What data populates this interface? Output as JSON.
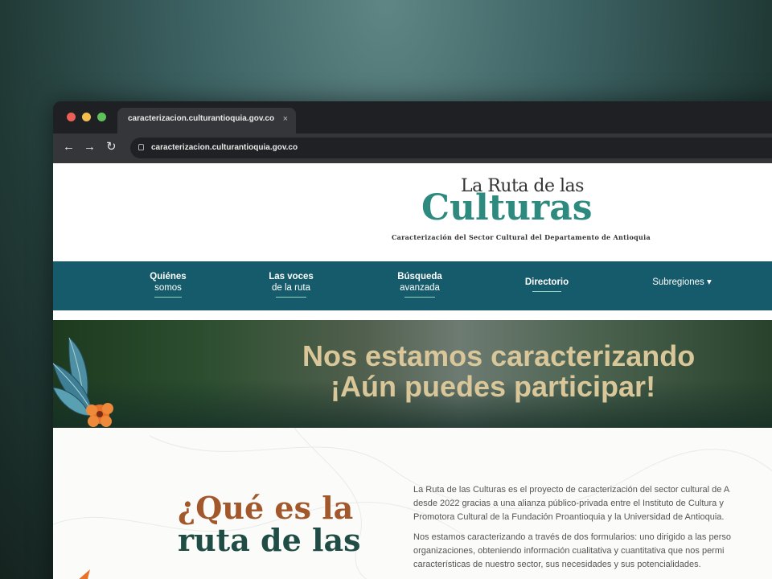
{
  "browser": {
    "tab_title": "caracterizacion.culturantioquia.gov.co",
    "tab_close": "×",
    "url": "caracterizacion.culturantioquia.gov.co",
    "back": "←",
    "forward": "→",
    "reload": "↻"
  },
  "header": {
    "logo_top": "La Ruta de las",
    "logo_main": "Culturas",
    "logo_sub": "Caracterización del Sector Cultural del Departamento de Antioquia"
  },
  "nav": {
    "items": [
      {
        "line1": "Quiénes",
        "line2": "somos"
      },
      {
        "line1": "Las voces",
        "line2": "de la ruta"
      },
      {
        "line1": "Búsqueda",
        "line2": "avanzada"
      },
      {
        "line1": "Directorio",
        "line2": ""
      },
      {
        "line1": "Subregiones ▾",
        "line2": ""
      }
    ]
  },
  "banner": {
    "line1": "Nos estamos caracterizando",
    "line2": "¡Aún puedes participar!"
  },
  "about": {
    "heading_line1": "¿Qué es la",
    "heading_line2": "ruta de las",
    "paragraph1_line1": "La Ruta de las Culturas es el proyecto de caracterización del sector cultural de A",
    "paragraph1_line2": "desde 2022 gracias a una alianza público-privada entre el Instituto de Cultura y",
    "paragraph1_line3": "Promotora Cultural de la Fundación Proantioquia y la Universidad de Antioquia.",
    "paragraph2_line1": "Nos estamos caracterizando a través de dos formularios: uno dirigido a las perso",
    "paragraph2_line2": "organizaciones, obteniendo información cualitativa y cuantitativa que nos permi",
    "paragraph2_line3": "características de nuestro sector, sus necesidades y sus potencialidades."
  },
  "colors": {
    "nav_bg": "#155b6b",
    "logo_teal": "#2e8a7e",
    "banner_text": "#d9c79a",
    "heading_brown": "#a3582b",
    "heading_green": "#1f4d45"
  }
}
